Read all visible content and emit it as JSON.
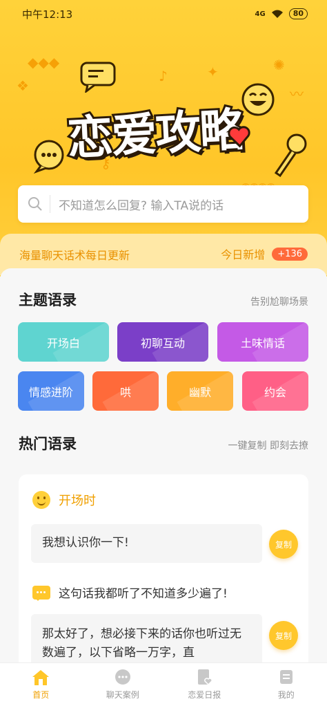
{
  "status": {
    "time": "中午12:13",
    "network": "4G",
    "battery": "80"
  },
  "hero": {
    "title": "恋爱攻略"
  },
  "search": {
    "placeholder": "不知道怎么回复? 输入TA说的话"
  },
  "banner": {
    "left": "海量聊天话术每日更新",
    "right": "今日新增",
    "badge": "+136"
  },
  "themes": {
    "title": "主题语录",
    "subtitle": "告别尬聊场景",
    "items": [
      {
        "label": "开场白",
        "color": "#5fd4d0"
      },
      {
        "label": "初聊互动",
        "color": "#7b3fc8"
      },
      {
        "label": "土味情话",
        "color": "#c45ae6"
      },
      {
        "label": "情感进阶",
        "color": "#4a86f0"
      },
      {
        "label": "哄",
        "color": "#ff6a3a"
      },
      {
        "label": "幽默",
        "color": "#ffae2a"
      },
      {
        "label": "约会",
        "color": "#ff5f86"
      }
    ]
  },
  "hot": {
    "title": "热门语录",
    "subtitle": "一键复制 即刻去撩",
    "card": {
      "heading": "开场时",
      "quote1": "我想认识你一下!",
      "quote2_prompt": "这句话我都听了不知道多少遍了!",
      "quote2_reply": "那太好了，想必接下来的话你也听过无数遍了，以下省略一万字，直",
      "copy_label": "复制"
    }
  },
  "tabs": [
    {
      "label": "首页",
      "active": true
    },
    {
      "label": "聊天案例",
      "active": false
    },
    {
      "label": "恋爱日报",
      "active": false
    },
    {
      "label": "我的",
      "active": false
    }
  ]
}
